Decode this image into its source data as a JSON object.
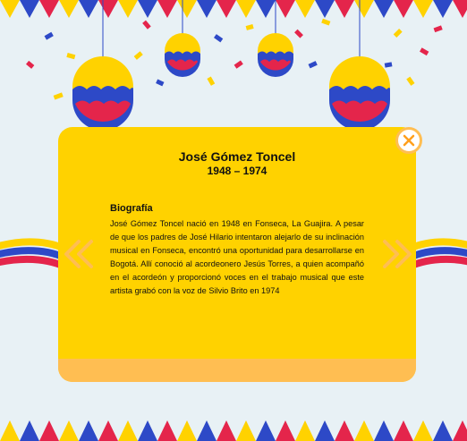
{
  "card": {
    "title": "José Gómez Toncel",
    "years": "1948 – 1974",
    "section_heading": "Biografía",
    "bio": "José Gómez Toncel nació en 1948 en Fonseca, La Guajira. A pesar de que los padres de José Hilario intentaron alejarlo de su inclinación musical en Fonseca, encontró una oportunidad para desarrollarse en Bogotá. Allí conoció al acordeonero Jesús Torres, a quien acompañó en el acordeón y proporcionó voces en el trabajo musical que este artista grabó con la voz de Silvio Brito en 1974"
  },
  "colors": {
    "background": "#e8f1f5",
    "card": "#ffd200",
    "card_footer": "#ffbe52",
    "flag_yellow": "#ffd200",
    "flag_blue": "#2d49c7",
    "flag_red": "#e4254b",
    "accent_orange": "#ffbe52"
  },
  "icons": {
    "close": "close-x-circle-icon",
    "prev": "double-chevron-left-icon",
    "next": "double-chevron-right-icon"
  }
}
